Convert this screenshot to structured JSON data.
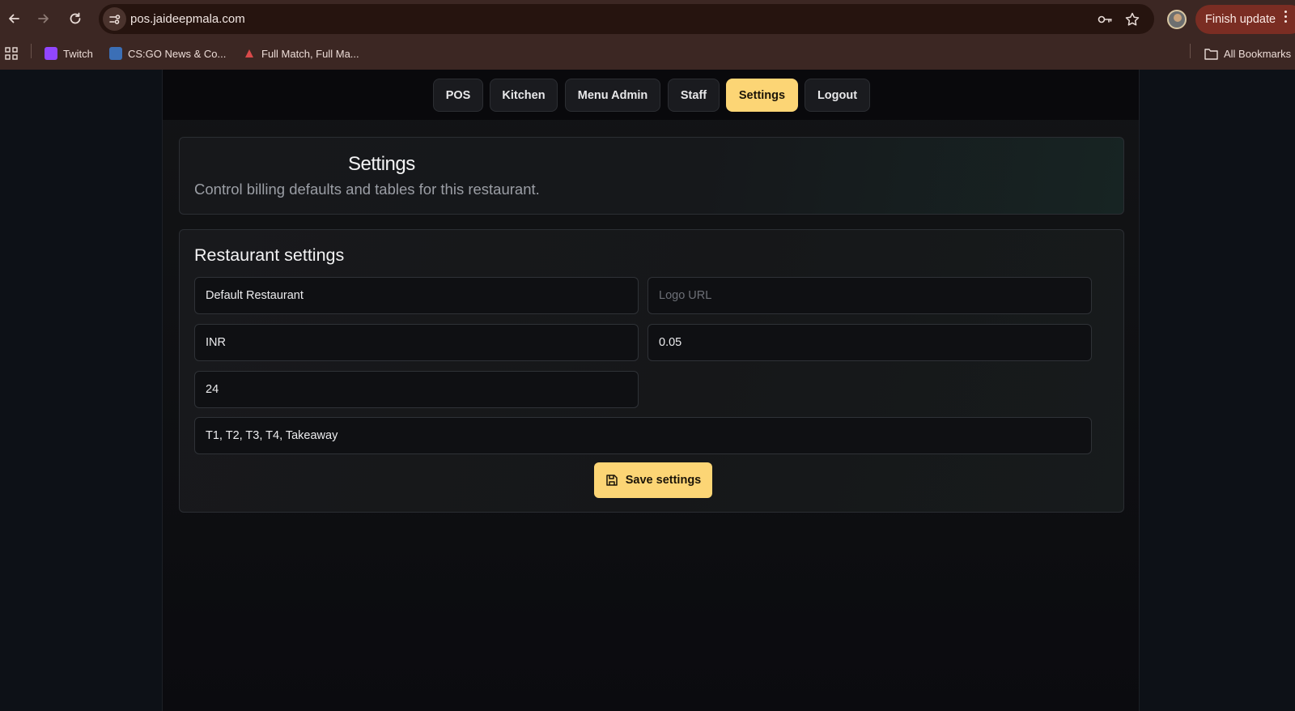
{
  "browser": {
    "url": "pos.jaideepmala.com",
    "finish_update_label": "Finish update",
    "bookmarks": [
      {
        "label": "Twitch",
        "icon": "twitch-icon",
        "color": "#9146ff"
      },
      {
        "label": "CS:GO News & Co...",
        "icon": "csgo-icon",
        "color": "#3b6fb6"
      },
      {
        "label": "Full Match, Full Ma...",
        "icon": "fullmatch-icon",
        "color": "#d94a4a"
      }
    ],
    "all_bookmarks_label": "All Bookmarks"
  },
  "nav": {
    "tabs": [
      {
        "label": "POS",
        "active": false
      },
      {
        "label": "Kitchen",
        "active": false
      },
      {
        "label": "Menu Admin",
        "active": false
      },
      {
        "label": "Staff",
        "active": false
      },
      {
        "label": "Settings",
        "active": true
      },
      {
        "label": "Logout",
        "active": false
      }
    ]
  },
  "header": {
    "title": "Settings",
    "subtitle": "Control billing defaults and tables for this restaurant."
  },
  "form": {
    "title": "Restaurant settings",
    "restaurant_name": "Default Restaurant",
    "logo_url_placeholder": "Logo URL",
    "currency": "INR",
    "tax_rate": "0.05",
    "number_value": "24",
    "tables": "T1, T2, T3, T4, Takeaway",
    "save_label": "Save settings"
  },
  "colors": {
    "accent": "#fcd575",
    "browser_frame": "#3c2723",
    "page_background": "#0d1117"
  }
}
